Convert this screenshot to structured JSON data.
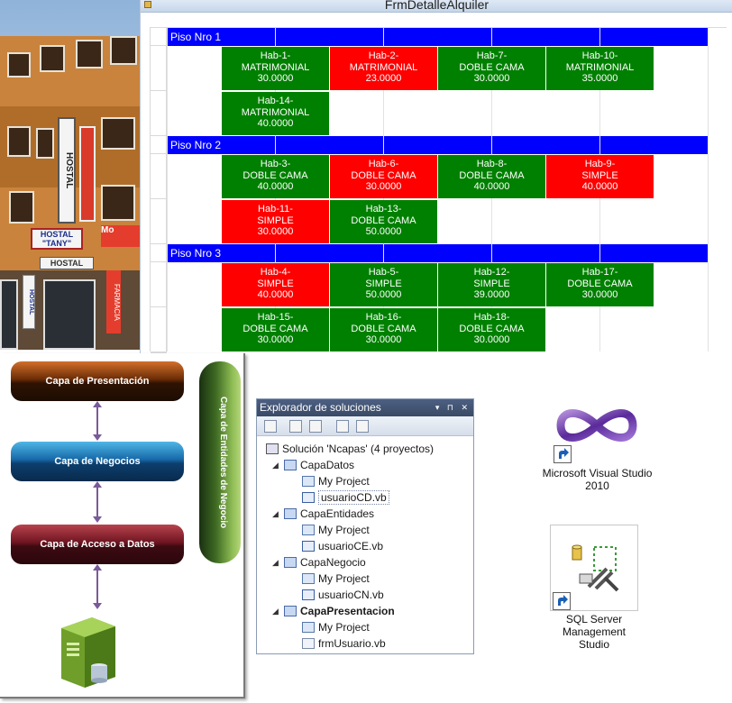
{
  "form": {
    "title": "FrmDetalleAlquiler",
    "floors": [
      {
        "label": "Piso Nro 1",
        "rooms": [
          {
            "name": "Hab-1-",
            "type": "MATRIMONIAL",
            "price": "30.0000",
            "status": "green"
          },
          {
            "name": "Hab-2-",
            "type": "MATRIMONIAL",
            "price": "23.0000",
            "status": "red"
          },
          {
            "name": "Hab-7-",
            "type": "DOBLE CAMA",
            "price": "30.0000",
            "status": "green"
          },
          {
            "name": "Hab-10-",
            "type": "MATRIMONIAL",
            "price": "35.0000",
            "status": "green"
          },
          {
            "name": "Hab-14-",
            "type": "MATRIMONIAL",
            "price": "40.0000",
            "status": "green"
          }
        ]
      },
      {
        "label": "Piso Nro 2",
        "rooms": [
          {
            "name": "Hab-3-",
            "type": "DOBLE CAMA",
            "price": "40.0000",
            "status": "green"
          },
          {
            "name": "Hab-6-",
            "type": "DOBLE CAMA",
            "price": "30.0000",
            "status": "red"
          },
          {
            "name": "Hab-8-",
            "type": "DOBLE CAMA",
            "price": "40.0000",
            "status": "green"
          },
          {
            "name": "Hab-9-",
            "type": "SIMPLE",
            "price": "40.0000",
            "status": "red"
          },
          {
            "name": "Hab-11-",
            "type": "SIMPLE",
            "price": "30.0000",
            "status": "red"
          },
          {
            "name": "Hab-13-",
            "type": "DOBLE CAMA",
            "price": "50.0000",
            "status": "green"
          }
        ]
      },
      {
        "label": "Piso Nro 3",
        "rooms": [
          {
            "name": "Hab-4-",
            "type": "SIMPLE",
            "price": "40.0000",
            "status": "red"
          },
          {
            "name": "Hab-5-",
            "type": "SIMPLE",
            "price": "50.0000",
            "status": "green"
          },
          {
            "name": "Hab-12-",
            "type": "SIMPLE",
            "price": "39.0000",
            "status": "green"
          },
          {
            "name": "Hab-17-",
            "type": "DOBLE CAMA",
            "price": "30.0000",
            "status": "green"
          },
          {
            "name": "Hab-15-",
            "type": "DOBLE CAMA",
            "price": "30.0000",
            "status": "green"
          },
          {
            "name": "Hab-16-",
            "type": "DOBLE CAMA",
            "price": "30.0000",
            "status": "green"
          },
          {
            "name": "Hab-18-",
            "type": "DOBLE CAMA",
            "price": "30.0000",
            "status": "green"
          }
        ]
      }
    ],
    "colors": {
      "available": "#008000",
      "occupied": "#ff0000",
      "floor_header": "#0000ff"
    }
  },
  "photo": {
    "sign_hostal": "HOSTAL",
    "sign_tany": "\"TANY\"",
    "sign_hostal2": "HOSTAL",
    "sign_farmacia": "FARMACIA",
    "sign_mo": "Mo"
  },
  "architecture": {
    "presentacion": "Capa de Presentación",
    "negocios": "Capa de Negocios",
    "acceso": "Capa de Acceso a Datos",
    "entidades": "Capa de Entidades de Negocio"
  },
  "explorer": {
    "title": "Explorador de soluciones",
    "title_buttons": "▾ ⊓ ✕",
    "solution": "Solución 'Ncapas'  (4 proyectos)",
    "projects": [
      {
        "name": "CapaDatos",
        "bold": false,
        "items": [
          "My Project",
          "usuarioCD.vb"
        ]
      },
      {
        "name": "CapaEntidades",
        "bold": false,
        "items": [
          "My Project",
          "usuarioCE.vb"
        ]
      },
      {
        "name": "CapaNegocio",
        "bold": false,
        "items": [
          "My Project",
          "usuarioCN.vb"
        ]
      },
      {
        "name": "CapaPresentacion",
        "bold": true,
        "items": [
          "My Project",
          "frmUsuario.vb"
        ]
      }
    ]
  },
  "shortcuts": {
    "vs": "Microsoft Visual Studio 2010",
    "sql": "SQL Server Management Studio"
  }
}
